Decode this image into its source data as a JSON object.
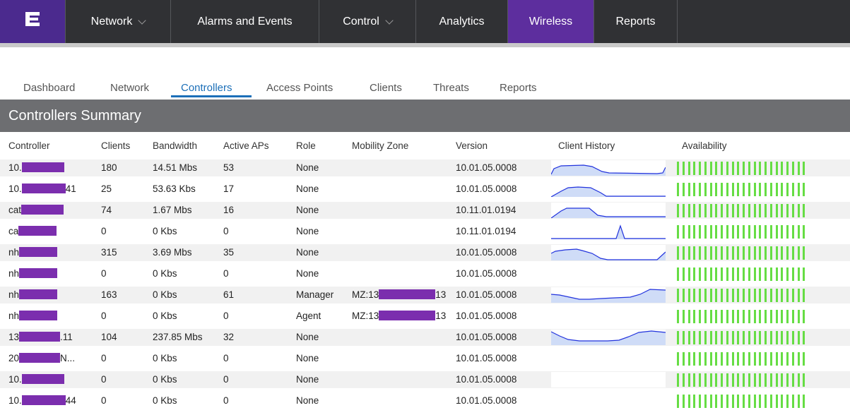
{
  "nav": {
    "logo_icon": "extreme-logo-icon",
    "items": [
      {
        "label": "Network",
        "dropdown": true,
        "active": false
      },
      {
        "label": "Alarms and Events",
        "dropdown": false,
        "active": false
      },
      {
        "label": "Control",
        "dropdown": true,
        "active": false
      },
      {
        "label": "Analytics",
        "dropdown": false,
        "active": false
      },
      {
        "label": "Wireless",
        "dropdown": false,
        "active": true
      },
      {
        "label": "Reports",
        "dropdown": false,
        "active": false
      }
    ]
  },
  "subtabs": [
    {
      "label": "Dashboard",
      "active": false
    },
    {
      "label": "Network",
      "active": false
    },
    {
      "label": "Controllers",
      "active": true
    },
    {
      "label": "Access Points",
      "active": false
    },
    {
      "label": "Clients",
      "active": false
    },
    {
      "label": "Threats",
      "active": false
    },
    {
      "label": "Reports",
      "active": false
    }
  ],
  "panel": {
    "title": "Controllers Summary"
  },
  "table": {
    "columns": [
      "Controller",
      "Clients",
      "Bandwidth",
      "Active APs",
      "Role",
      "Mobility Zone",
      "Version",
      "Client History",
      "Availability"
    ],
    "rows": [
      {
        "controller_prefix": "10.",
        "controller_suffix": "",
        "clients": "180",
        "bandwidth": "14.51 Mbs",
        "active_aps": "53",
        "role": "None",
        "mz_prefix": "",
        "mz_suffix": "",
        "version": "10.01.05.0008",
        "history": "plateau-1"
      },
      {
        "controller_prefix": "10.",
        "controller_suffix": "41",
        "clients": "25",
        "bandwidth": "53.63 Kbs",
        "active_aps": "17",
        "role": "None",
        "mz_prefix": "",
        "mz_suffix": "",
        "version": "10.01.05.0008",
        "history": "plateau-2"
      },
      {
        "controller_prefix": "cat",
        "controller_suffix": "",
        "clients": "74",
        "bandwidth": "1.67 Mbs",
        "active_aps": "16",
        "role": "None",
        "mz_prefix": "",
        "mz_suffix": "",
        "version": "10.11.01.0194",
        "history": "plateau-3"
      },
      {
        "controller_prefix": "ca",
        "controller_suffix": "",
        "clients": "0",
        "bandwidth": "0 Kbs",
        "active_aps": "0",
        "role": "None",
        "mz_prefix": "",
        "mz_suffix": "",
        "version": "10.11.01.0194",
        "history": "spike"
      },
      {
        "controller_prefix": "nh",
        "controller_suffix": "",
        "clients": "315",
        "bandwidth": "3.69 Mbs",
        "active_aps": "35",
        "role": "None",
        "mz_prefix": "",
        "mz_suffix": "",
        "version": "10.01.05.0008",
        "history": "plateau-4"
      },
      {
        "controller_prefix": "nh",
        "controller_suffix": "",
        "clients": "0",
        "bandwidth": "0 Kbs",
        "active_aps": "0",
        "role": "None",
        "mz_prefix": "",
        "mz_suffix": "",
        "version": "10.01.05.0008",
        "history": "none"
      },
      {
        "controller_prefix": "nh",
        "controller_suffix": "",
        "clients": "163",
        "bandwidth": "0 Kbs",
        "active_aps": "61",
        "role": "Manager",
        "mz_prefix": "MZ:13",
        "mz_suffix": "13",
        "version": "10.01.05.0008",
        "history": "wave-1"
      },
      {
        "controller_prefix": "nh",
        "controller_suffix": "",
        "clients": "0",
        "bandwidth": "0 Kbs",
        "active_aps": "0",
        "role": "Agent",
        "mz_prefix": "MZ:13",
        "mz_suffix": "13",
        "version": "10.01.05.0008",
        "history": "none"
      },
      {
        "controller_prefix": "13",
        "controller_suffix": ".11",
        "clients": "104",
        "bandwidth": "237.85 Mbs",
        "active_aps": "32",
        "role": "None",
        "mz_prefix": "",
        "mz_suffix": "",
        "version": "10.01.05.0008",
        "history": "wave-2"
      },
      {
        "controller_prefix": "20",
        "controller_suffix": "N...",
        "clients": "0",
        "bandwidth": "0 Kbs",
        "active_aps": "0",
        "role": "None",
        "mz_prefix": "",
        "mz_suffix": "",
        "version": "10.01.05.0008",
        "history": "none"
      },
      {
        "controller_prefix": "10.",
        "controller_suffix": "",
        "clients": "0",
        "bandwidth": "0 Kbs",
        "active_aps": "0",
        "role": "None",
        "mz_prefix": "",
        "mz_suffix": "",
        "version": "10.01.05.0008",
        "history": "none"
      },
      {
        "controller_prefix": "10.",
        "controller_suffix": "44",
        "clients": "0",
        "bandwidth": "0 Kbs",
        "active_aps": "0",
        "role": "None",
        "mz_prefix": "",
        "mz_suffix": "",
        "version": "10.01.05.0008",
        "history": "none"
      }
    ],
    "availability_bar_count": 24
  },
  "colors": {
    "brand": "#4b2a8e",
    "nav_active": "#5d2e9e",
    "nav_bg": "#303134",
    "tab_active": "#1c6fb8",
    "panel_header": "#6d6e71",
    "redaction": "#7b2eae",
    "availability": "#66dd44",
    "history_line": "#2233dd",
    "history_fill": "#cfdcf7"
  }
}
